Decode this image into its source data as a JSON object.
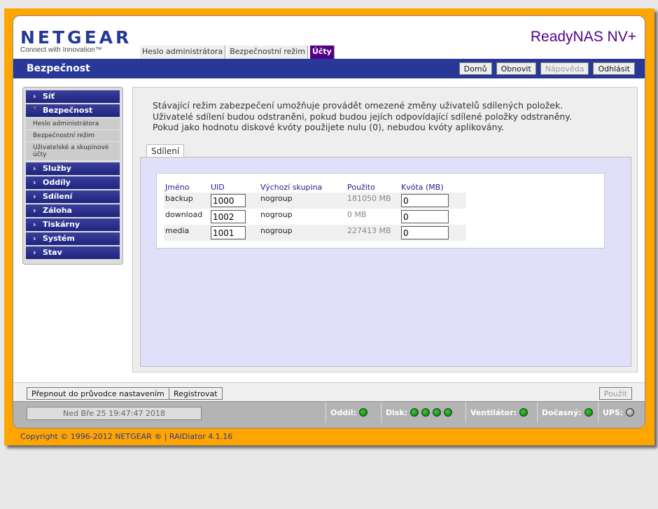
{
  "header": {
    "logo": "NETGEAR",
    "tagline": "Connect with Innovation™",
    "product": "ReadyNAS NV+",
    "tabs": [
      {
        "label": "Heslo administrátora",
        "active": false
      },
      {
        "label": "Bezpečnostní režim",
        "active": false
      },
      {
        "label": "Účty",
        "active": true
      }
    ],
    "section_title": "Bezpečnost",
    "buttons": {
      "home": "Domů",
      "refresh": "Obnovit",
      "help": "Nápověda",
      "logout": "Odhlásit"
    }
  },
  "sidebar": {
    "items": [
      {
        "label": "Síť"
      },
      {
        "label": "Bezpečnost",
        "open": true,
        "sub": [
          "Heslo administrátora",
          "Bezpečnostní režim",
          "Uživatelské a skupinové účty"
        ]
      },
      {
        "label": "Služby"
      },
      {
        "label": "Oddíly"
      },
      {
        "label": "Sdílení"
      },
      {
        "label": "Záloha"
      },
      {
        "label": "Tiskárny"
      },
      {
        "label": "Systém"
      },
      {
        "label": "Stav"
      }
    ]
  },
  "main": {
    "intro": "Stávající režim zabezpečení umožňuje provádět omezené změny uživatelů sdílených položek. Uživatelé sdílení budou odstraněni, pokud budou jejích odpovídající sdílené položky odstraněny. Pokud jako hodnotu diskové kvóty použijete nulu (0), nebudou kvóty aplikovány.",
    "tab": "Sdílení",
    "columns": [
      "Jméno",
      "UID",
      "Výchozí skupina",
      "Použito",
      "Kvóta (MB)"
    ],
    "rows": [
      {
        "name": "backup",
        "uid": "1000",
        "group": "nogroup",
        "used": "181050 MB",
        "quota": "0"
      },
      {
        "name": "download",
        "uid": "1002",
        "group": "nogroup",
        "used": "0 MB",
        "quota": "0"
      },
      {
        "name": "media",
        "uid": "1001",
        "group": "nogroup",
        "used": "227413 MB",
        "quota": "0"
      }
    ]
  },
  "bottom": {
    "wizard": "Přepnout do průvodce nastavením",
    "register": "Registrovat",
    "apply": "Použít"
  },
  "status": {
    "clock": "Ned Bře 25  19:47:47 2018",
    "volume": "Oddíl:",
    "disk": "Disk:",
    "fan": "Ventilátor:",
    "temp": "Dočasný:",
    "ups": "UPS:"
  },
  "footer": "Copyright © 1996-2012 NETGEAR ® | RAIDiator 4.1.16"
}
